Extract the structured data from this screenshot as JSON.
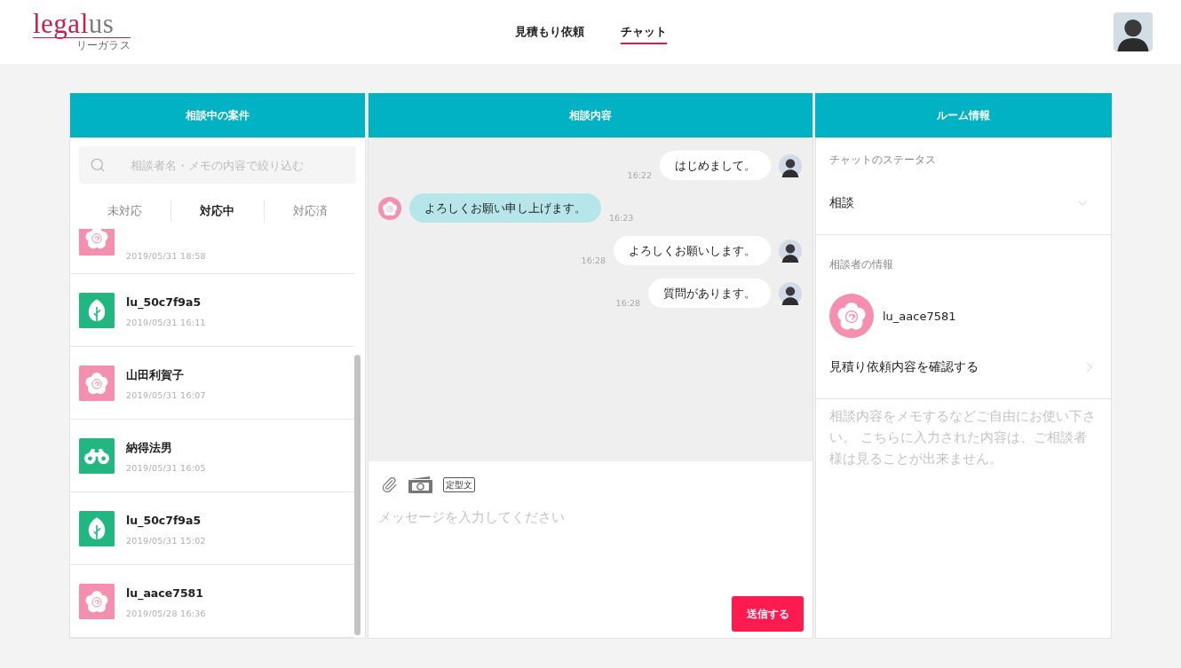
{
  "header": {
    "logo": {
      "parts": [
        {
          "text": "legal",
          "color": "#c3214b"
        },
        {
          "text": "us",
          "color": "#7e7e7e"
        }
      ],
      "subtitle": "リーガラス"
    },
    "nav": [
      {
        "label": "見積もり依頼",
        "selected": false
      },
      {
        "label": "チャット",
        "selected": true
      }
    ]
  },
  "cases": {
    "title": "相談中の案件",
    "search": {
      "placeholder": "相談者名・メモの内容で絞り込む"
    },
    "tabs": [
      {
        "label": "未対応",
        "selected": false
      },
      {
        "label": "対応中",
        "selected": true
      },
      {
        "label": "対応済",
        "selected": false
      }
    ],
    "items": [
      {
        "kind": "flower",
        "date": "2019/05/31 18:58"
      },
      {
        "kind": "leaf",
        "name": "lu_50c7f9a5",
        "date": "2019/05/31 16:11"
      },
      {
        "kind": "flower",
        "name": "山田利賀子",
        "date": "2019/05/31 16:07"
      },
      {
        "kind": "binoculars",
        "name": "納得法男",
        "date": "2019/05/31 16:05"
      },
      {
        "kind": "leaf",
        "name": "lu_50c7f9a5",
        "date": "2019/05/31 15:02"
      },
      {
        "kind": "flower",
        "name": "lu_aace7581",
        "date": "2019/05/28 16:36"
      }
    ]
  },
  "chat": {
    "title": "相談内容",
    "messages": [
      {
        "kind": "sent",
        "avatar": {
          "kind": "photo"
        },
        "text": "はじめまして。",
        "time": "16:22"
      },
      {
        "kind": "received",
        "avatar": {
          "kind": "flower"
        },
        "text": "よろしくお願い申し上げます。",
        "time": "16:23"
      },
      {
        "kind": "sent",
        "avatar": {
          "kind": "photo"
        },
        "text": "よろしくお願いします。",
        "time": "16:28"
      },
      {
        "kind": "sent",
        "avatar": {
          "kind": "photo"
        },
        "text": "質問があります。",
        "time": "16:28"
      }
    ],
    "composer": {
      "template_label": "定型文",
      "placeholder": "メッセージを入力してください",
      "send_label": "送信する"
    }
  },
  "room_info": {
    "title": "ルーム情報",
    "status": {
      "label": "チャットのステータス",
      "value": "相談"
    },
    "client": {
      "label": "相談者の情報",
      "avatar": {
        "kind": "flower"
      },
      "name": "lu_aace7581",
      "link": "見積り依頼内容を確認する"
    },
    "memo": {
      "placeholder": "相談内容をメモするなどご自由にお使い下さい。 こちらに入力された内容は、ご相談者様は見ることが出来ません。"
    }
  }
}
